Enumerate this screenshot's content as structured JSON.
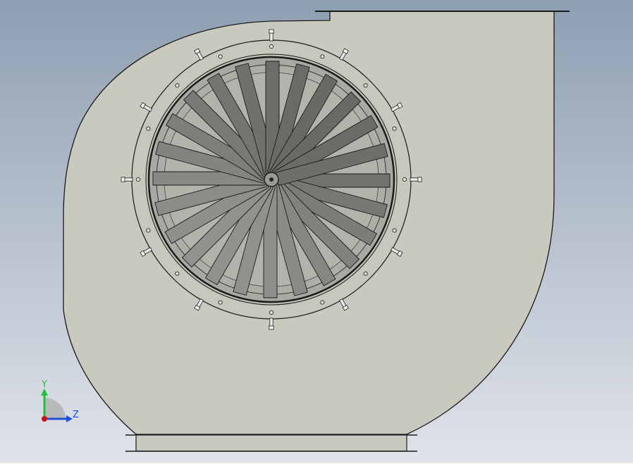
{
  "scene": {
    "background_top": "#8fa0b3",
    "background_bottom": "#dde1e8",
    "housing_fill": "#c9c9bf",
    "outline": "#1a1a1a",
    "ring_fill": "#c4c4ba",
    "opening_fill": "#a9a9a1",
    "blade_count": 24,
    "flange_hole_count": 16,
    "flange_bolt_count": 12
  },
  "triad": {
    "y_label": "Y",
    "z_label": "Z",
    "y_color": "#22c040",
    "z_color": "#1f4fd6",
    "x_color": "#d01010"
  }
}
